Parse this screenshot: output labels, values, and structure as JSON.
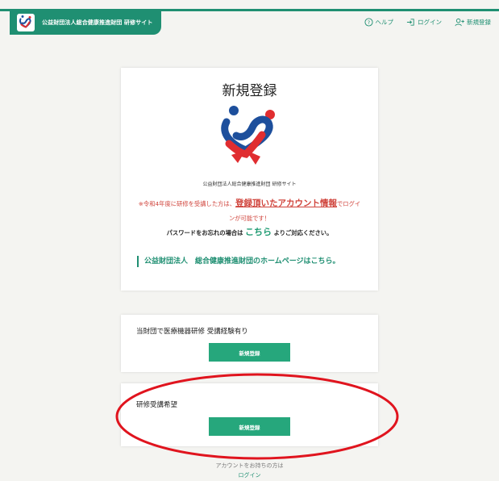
{
  "header": {
    "site_name": "公益財団法人総合健康推進財団 研修サイト",
    "nav": {
      "help": "ヘルプ",
      "login": "ログイン",
      "register": "新規登録"
    }
  },
  "main_card": {
    "title": "新規登録",
    "subtitle": "公益財団法人総合健康推進財団 研修サイト",
    "notice_part1": "※令和4年度に研修を受講した方は、",
    "notice_link": "登録頂いたアカウント情報",
    "notice_part2": "でログインが可能です！",
    "password_prefix": "パスワードをお忘れの場合は",
    "password_link": "こちら",
    "password_suffix": "よりご対応ください。",
    "homepage_link": "公益財団法人　総合健康推進財団のホームページはこちら。"
  },
  "experienced_card": {
    "label": "当財団で医療機器研修 受講経験有り",
    "button": "新規登録"
  },
  "applicant_card": {
    "label": "研修受講希望",
    "button": "新規登録"
  },
  "footer": {
    "account_text": "アカウントをお持ちの方は",
    "login_link": "ログイン"
  },
  "colors": {
    "brand": "#1f8f72",
    "button": "#26a77c",
    "notice": "#d0443c",
    "highlight_ellipse": "#e0141e"
  },
  "icons": {
    "logo": "heart-ribbon-logo",
    "help": "question-circle-icon",
    "login": "login-arrow-icon",
    "register": "add-user-icon"
  }
}
